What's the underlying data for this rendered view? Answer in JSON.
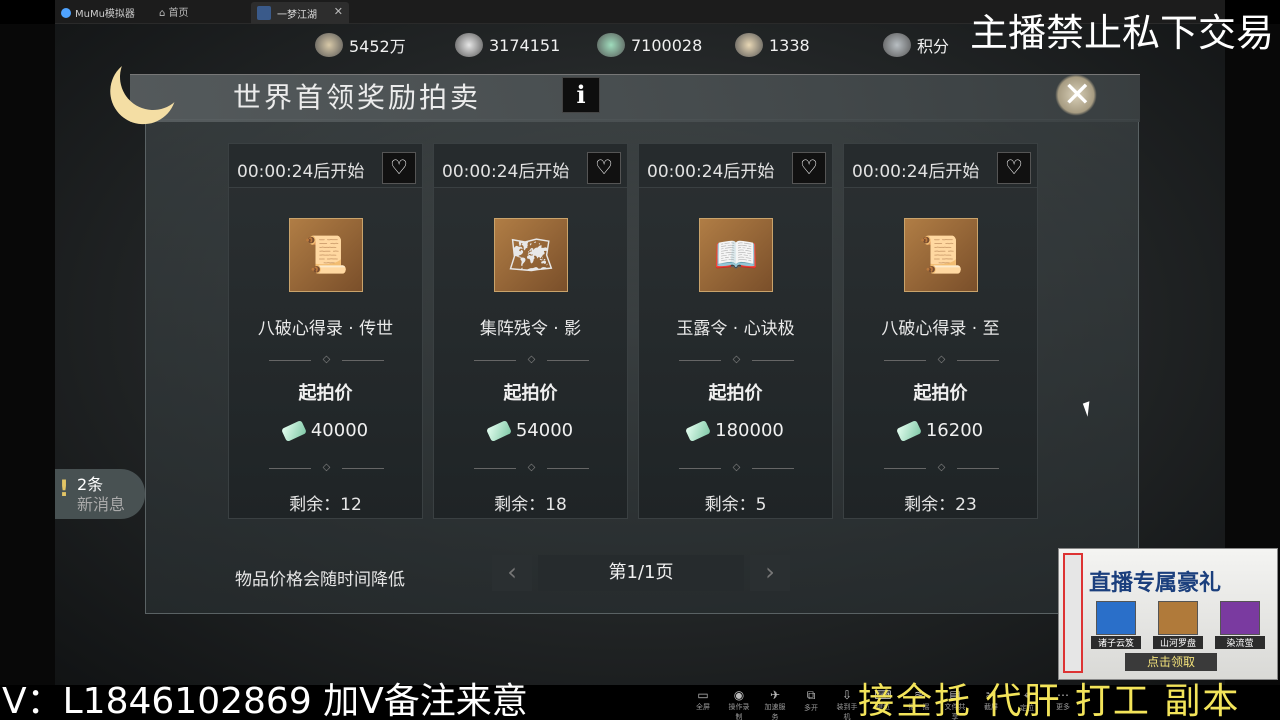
{
  "emulator": {
    "app_title": "MuMu模拟器",
    "home_label": "首页",
    "tab_label": "一梦江湖",
    "tab_close": "✕"
  },
  "currencies": [
    {
      "icon": "coin-pouch-icon",
      "value": "5452万",
      "color": "#d8c9a8"
    },
    {
      "icon": "silver-ingot-icon",
      "value": "3174151",
      "color": "#e6e6e6"
    },
    {
      "icon": "jade-plus-icon",
      "value": "7100028",
      "color": "#9fdcbc"
    },
    {
      "icon": "gold-ingot-plus-icon",
      "value": "1338",
      "color": "#e8d7b5"
    },
    {
      "icon": "points-shield-icon",
      "value": "积分",
      "color": "#b8bec2"
    }
  ],
  "panel": {
    "title": "世界首领奖励拍卖",
    "info_label": "i",
    "close_label": "✕"
  },
  "auction_items": [
    {
      "timer": "00:00:24后开始",
      "name": "八破心得录 · 传世",
      "price_label": "起拍价",
      "price": "40000",
      "remaining": "剩余：12",
      "icon": "golden-scroll-icon",
      "glyph": "📜"
    },
    {
      "timer": "00:00:24后开始",
      "name": "集阵残令 · 影",
      "price_label": "起拍价",
      "price": "54000",
      "remaining": "剩余：18",
      "icon": "torn-order-scroll-icon",
      "glyph": "🗺"
    },
    {
      "timer": "00:00:24后开始",
      "name": "玉露令 · 心诀极",
      "price_label": "起拍价",
      "price": "180000",
      "remaining": "剩余：5",
      "icon": "open-book-scroll-icon",
      "glyph": "📖"
    },
    {
      "timer": "00:00:24后开始",
      "name": "八破心得录 · 至",
      "price_label": "起拍价",
      "price": "16200",
      "remaining": "剩余：23",
      "icon": "golden-scroll-icon",
      "glyph": "📜"
    }
  ],
  "footer": {
    "note": "物品价格会随时间降低",
    "page": "第1/1页",
    "prev": "‹",
    "next": "›"
  },
  "messages": {
    "count": "2条",
    "label": "新消息"
  },
  "overlay": {
    "top_notice": "主播禁止私下交易",
    "contact": "V：L1846102869 加V备注来意",
    "service": "接全托 代肝 打工 副本"
  },
  "toolbar": [
    {
      "icon": "fullscreen-icon",
      "label": "全屏"
    },
    {
      "icon": "record-icon",
      "label": "操作录制"
    },
    {
      "icon": "rocket-icon",
      "label": "加速服务"
    },
    {
      "icon": "multi-open-icon",
      "label": "多开"
    },
    {
      "icon": "install-icon",
      "label": "装到手机"
    },
    {
      "icon": "keyboard-icon",
      "label": "键位"
    },
    {
      "icon": "shake-icon",
      "label": "摇一摇"
    },
    {
      "icon": "file-share-icon",
      "label": "文件共享"
    },
    {
      "icon": "screenshot-icon",
      "label": "截屏"
    },
    {
      "icon": "location-icon",
      "label": "定位"
    },
    {
      "icon": "more-icon",
      "label": "更多"
    }
  ],
  "promo": {
    "title": "直播专属豪礼",
    "gifts": [
      {
        "name": "诸子云笈",
        "color": "#2a6fc9"
      },
      {
        "name": "山河罗盘",
        "color": "#b07a3a"
      },
      {
        "name": "染流萤",
        "color": "#7a3aa0"
      }
    ],
    "claim": "点击领取"
  }
}
